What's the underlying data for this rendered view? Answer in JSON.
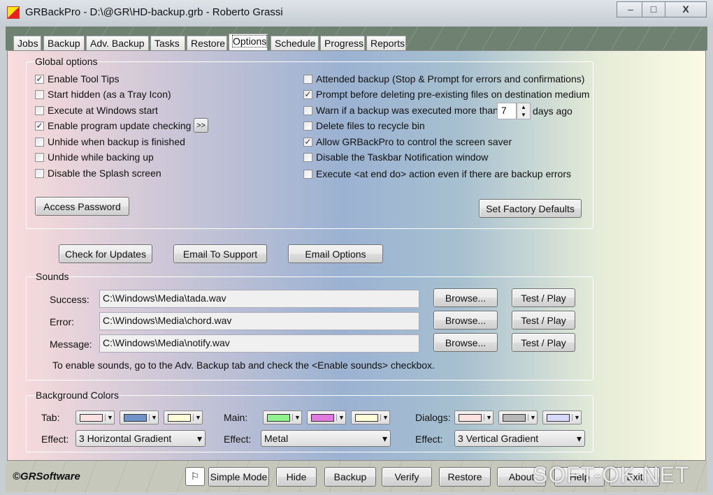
{
  "window": {
    "title": "GRBackPro - D:\\@GR\\HD-backup.grb - Roberto Grassi",
    "min": "–",
    "max": "□",
    "close": "X"
  },
  "tabs": [
    "Jobs",
    "Backup",
    "Adv. Backup",
    "Tasks",
    "Restore",
    "Options",
    "Schedule",
    "Progress",
    "Reports"
  ],
  "global": {
    "label": "Global options",
    "left": [
      {
        "label": "Enable Tool Tips",
        "checked": true
      },
      {
        "label": "Start hidden (as a Tray Icon)",
        "checked": false
      },
      {
        "label": "Execute at Windows start",
        "checked": false
      },
      {
        "label": "Enable program update checking",
        "checked": true
      },
      {
        "label": "Unhide when backup is finished",
        "checked": false
      },
      {
        "label": "Unhide while backing up",
        "checked": false
      },
      {
        "label": "Disable the Splash screen",
        "checked": false
      }
    ],
    "more_button": ">>",
    "right": [
      {
        "label": "Attended backup (Stop & Prompt for errors and confirmations)",
        "checked": false
      },
      {
        "label": "Prompt before deleting pre-existing files on destination medium",
        "checked": true
      },
      {
        "label": "Warn if a backup was executed more than",
        "checked": false
      },
      {
        "label": "Delete files to recycle bin",
        "checked": false
      },
      {
        "label": "Allow GRBackPro to control the screen saver",
        "checked": true
      },
      {
        "label": "Disable the Taskbar Notification window",
        "checked": false
      },
      {
        "label": "Execute <at end do> action even if there are backup errors",
        "checked": false
      }
    ],
    "warn_days": "7",
    "days_ago": "days ago",
    "access_password": "Access Password",
    "factory_defaults": "Set Factory Defaults"
  },
  "actions": {
    "check_updates": "Check for Updates",
    "email_support": "Email To Support",
    "email_options": "Email Options"
  },
  "sounds": {
    "label": "Sounds",
    "rows": [
      {
        "label": "Success:",
        "path": "C:\\Windows\\Media\\tada.wav"
      },
      {
        "label": "Error:",
        "path": "C:\\Windows\\Media\\chord.wav"
      },
      {
        "label": "Message:",
        "path": "C:\\Windows\\Media\\notify.wav"
      }
    ],
    "browse": "Browse...",
    "test": "Test / Play",
    "note": "To enable sounds, go to the Adv. Backup tab and check the <Enable sounds> checkbox."
  },
  "bg": {
    "label": "Background Colors",
    "tab_label": "Tab:",
    "main_label": "Main:",
    "dialogs_label": "Dialogs:",
    "effect_label": "Effect:",
    "tab_colors": [
      "#fde0e0",
      "#6f93c8",
      "#fdfdd8"
    ],
    "main_colors": [
      "#8ef28e",
      "#e07ae0",
      "#fdfdd8"
    ],
    "dialog_colors": [
      "#fde0e0",
      "#b8b8b8",
      "#d8d8fa"
    ],
    "tab_effect": "3 Horizontal Gradient",
    "main_effect": "Metal",
    "dialog_effect": "3 Vertical Gradient"
  },
  "footer": {
    "brand": "©GRSoftware",
    "buttons": [
      "Simple Mode",
      "Hide",
      "Backup",
      "Verify",
      "Restore",
      "About",
      "Help",
      "Exit"
    ],
    "watermark": "SOFT-OK.NET"
  }
}
